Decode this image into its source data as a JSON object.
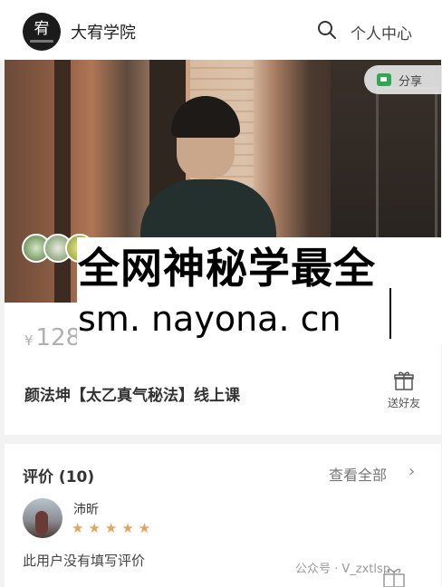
{
  "header": {
    "logo_glyph": "宥",
    "title": "大宥学院",
    "personal_center": "个人中心"
  },
  "hero": {
    "share_label": "分享"
  },
  "price": {
    "currency": "¥",
    "amount": "128"
  },
  "watermark": {
    "line1": "全网神秘学最全",
    "line2": "sm. nayona. cn"
  },
  "course": {
    "title": "颜法坤【太乙真气秘法】线上课",
    "gift_label": "送好友"
  },
  "reviews": {
    "title": "评价 (10)",
    "view_all": "查看全部",
    "chevron": "›",
    "items": [
      {
        "name": "沛昕",
        "rating": 5,
        "stars": "★★★★★",
        "comment": "此用户没有填写评价"
      }
    ]
  },
  "footer_watermark": "公众号 · V_zxtlsp",
  "colors": {
    "accent_star": "#e8a35a",
    "share_green": "#2fa84f",
    "background": "#f2f2f2"
  }
}
